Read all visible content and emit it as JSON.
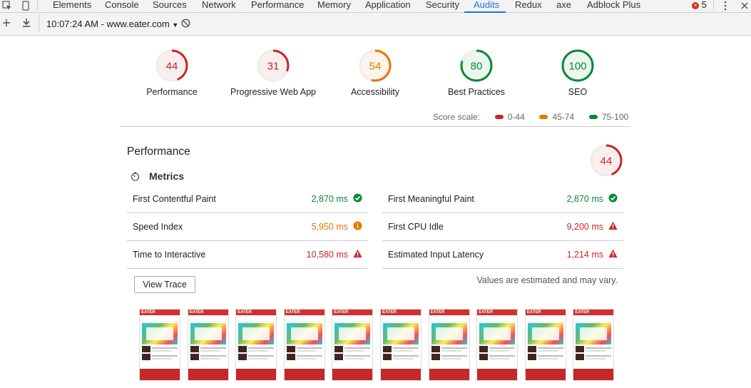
{
  "devtools": {
    "tabs": [
      {
        "label": "Elements"
      },
      {
        "label": "Console"
      },
      {
        "label": "Sources"
      },
      {
        "label": "Network"
      },
      {
        "label": "Performance"
      },
      {
        "label": "Memory"
      },
      {
        "label": "Application"
      },
      {
        "label": "Security"
      },
      {
        "label": "Audits"
      },
      {
        "label": "Redux"
      },
      {
        "label": "axe"
      },
      {
        "label": "Adblock Plus"
      }
    ],
    "active_tab": "Audits",
    "error_count": "5",
    "report_select": "10:07:24 AM - www.eater.com",
    "accent_color": "#1a73e8"
  },
  "gauges": [
    {
      "score": "44",
      "label": "Performance",
      "value": 44,
      "color": "#c62828"
    },
    {
      "score": "31",
      "label": "Progressive Web App",
      "value": 31,
      "color": "#c62828"
    },
    {
      "score": "54",
      "label": "Accessibility",
      "value": 54,
      "color": "#e67700"
    },
    {
      "score": "80",
      "label": "Best Practices",
      "value": 80,
      "color": "#0a8a35"
    },
    {
      "score": "100",
      "label": "SEO",
      "value": 100,
      "color": "#0a8a35"
    }
  ],
  "score_scale": {
    "label": "Score scale:",
    "ranges": [
      {
        "text": "0-44",
        "color": "#c62828"
      },
      {
        "text": "45-74",
        "color": "#e67700"
      },
      {
        "text": "75-100",
        "color": "#0a8a35"
      }
    ]
  },
  "performance": {
    "title": "Performance",
    "score": "44",
    "score_value": 44,
    "metrics_title": "Metrics",
    "metrics": [
      {
        "name": "First Contentful Paint",
        "value": "2,870 ms",
        "status": "pass",
        "color": "#0a8a35"
      },
      {
        "name": "First Meaningful Paint",
        "value": "2,870 ms",
        "status": "pass",
        "color": "#0a8a35"
      },
      {
        "name": "Speed Index",
        "value": "5,950 ms",
        "status": "average",
        "color": "#e67700"
      },
      {
        "name": "First CPU Idle",
        "value": "9,200 ms",
        "status": "fail",
        "color": "#c62828"
      },
      {
        "name": "Time to Interactive",
        "value": "10,580 ms",
        "status": "fail",
        "color": "#c62828"
      },
      {
        "name": "Estimated Input Latency",
        "value": "1,214 ms",
        "status": "fail",
        "color": "#c62828"
      }
    ],
    "note": "Values are estimated and may vary.",
    "view_trace": "View Trace",
    "filmstrip_logo": "EATER"
  }
}
